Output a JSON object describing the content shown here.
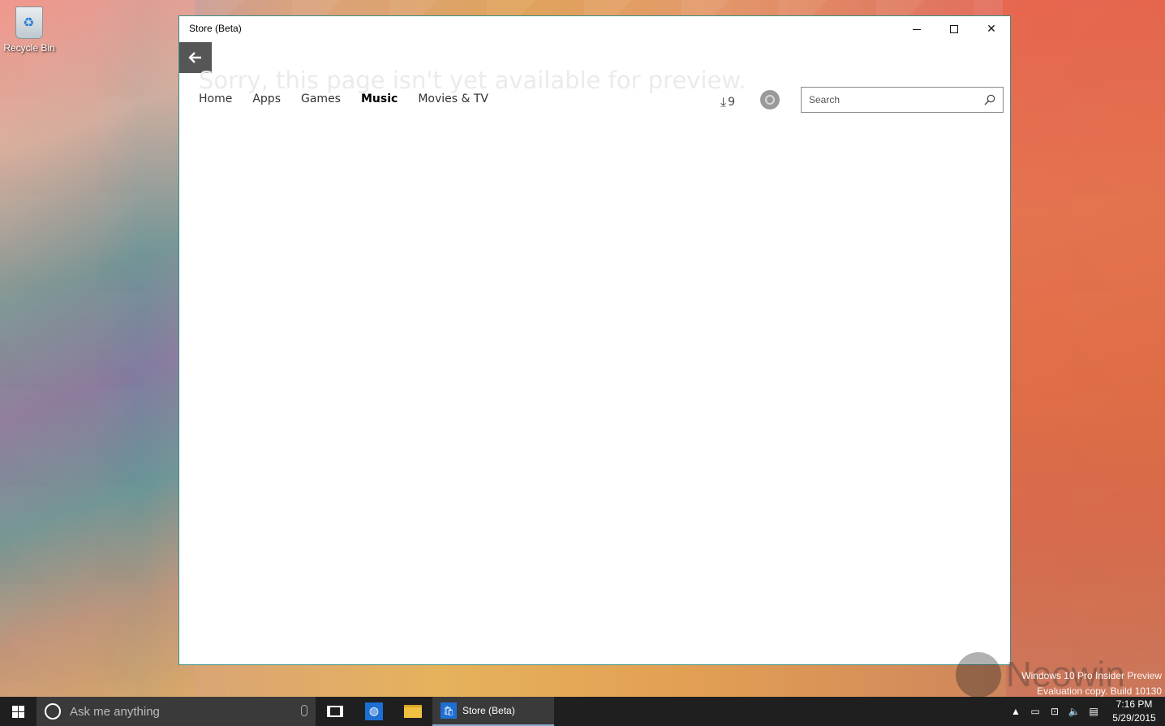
{
  "desktop": {
    "recycle_bin_label": "Recycle Bin"
  },
  "window": {
    "title": "Store (Beta)",
    "sorry_message": "Sorry, this page isn't yet available for preview.",
    "nav": {
      "tabs": [
        {
          "label": "Home",
          "active": false
        },
        {
          "label": "Apps",
          "active": false
        },
        {
          "label": "Games",
          "active": false
        },
        {
          "label": "Music",
          "active": true
        },
        {
          "label": "Movies & TV",
          "active": false
        }
      ]
    },
    "downloads_count": "9",
    "search_placeholder": "Search"
  },
  "watermark": {
    "line1": "Windows 10 Pro Insider Preview",
    "line2": "Evaluation copy. Build 10130",
    "brand": "Neowin"
  },
  "taskbar": {
    "cortana_placeholder": "Ask me anything",
    "running_app_label": "Store (Beta)",
    "time": "7:16 PM",
    "date": "5/29/2015"
  }
}
